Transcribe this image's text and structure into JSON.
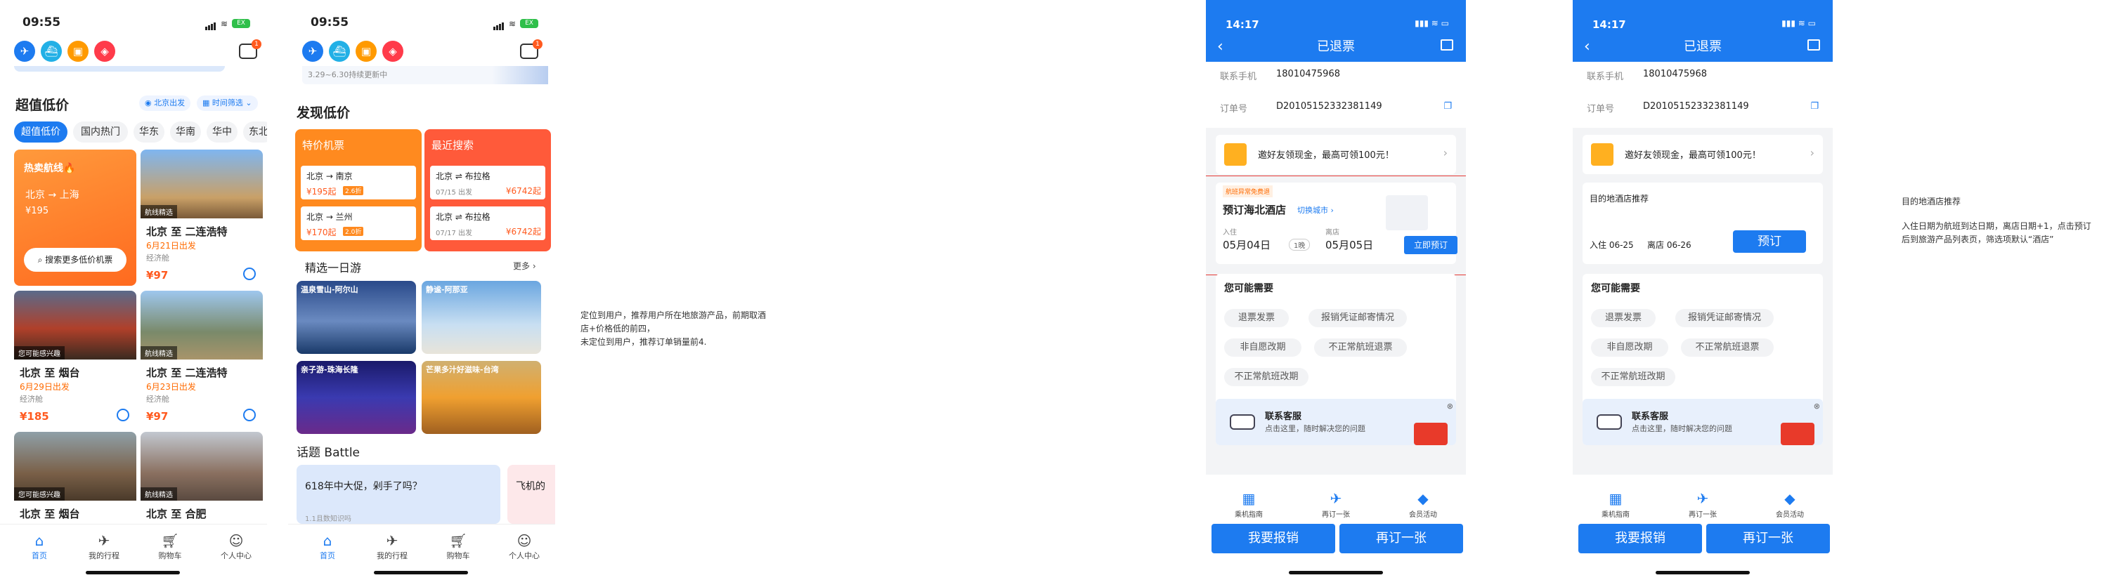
{
  "colors": {
    "primary": "#1d7bf0",
    "orange": "#ff6a00",
    "red": "#ff3b30"
  },
  "s1": {
    "time": "09:55",
    "section": "超值低价",
    "loc": "北京出发",
    "filter": "时间筛选",
    "chips": [
      "超值低价",
      "国内热门",
      "华东",
      "华南",
      "华中",
      "东北"
    ],
    "hot": {
      "tag": "热卖航线🔥",
      "route": "北京 → 上海",
      "price": "¥195",
      "search": "搜索更多低价机票"
    },
    "cards": [
      {
        "tag": "航线精选",
        "title": "北京 至 二连浩特",
        "date": "6月21日出发",
        "cls": "经济舱",
        "price": "¥97"
      },
      {
        "tag": "您可能感兴趣",
        "title": "北京 至 烟台",
        "date": "6月29日出发",
        "cls": "经济舱",
        "price": "¥185"
      },
      {
        "tag": "航线精选",
        "title": "北京 至 二连浩特",
        "date": "6月23日出发",
        "cls": "经济舱",
        "price": "¥97"
      },
      {
        "tag": "您可能感兴趣",
        "title": "北京 至 烟台",
        "date": "",
        "cls": "",
        "price": ""
      },
      {
        "tag": "航线精选",
        "title": "北京 至 合肥",
        "date": "",
        "cls": "",
        "price": ""
      }
    ],
    "tabs": [
      "首页",
      "我的行程",
      "购物车",
      "个人中心"
    ]
  },
  "s2": {
    "time": "09:55",
    "banner_note": "3.29~6.30持续更新中",
    "discover": "发现低价",
    "special": {
      "title": "特价机票",
      "rows": [
        {
          "route": "北京 → 南京",
          "price": "¥195起",
          "disc": "2.6折"
        },
        {
          "route": "北京 → 兰州",
          "price": "¥170起",
          "disc": "2.0折"
        }
      ]
    },
    "recent": {
      "title": "最近搜索",
      "rows": [
        {
          "route": "北京 ⇌ 布拉格",
          "date": "07/15 出发",
          "price": "¥6742起"
        },
        {
          "route": "北京 ⇌ 布拉格",
          "date": "07/17 出发",
          "price": "¥6742起"
        }
      ]
    },
    "daytrip": "精选一日游",
    "more": "更多",
    "trips": [
      "温泉雪山-阿尔山",
      "静谧-阿那亚",
      "亲子游-珠海长隆",
      "芒果多汁好滋味-台湾"
    ],
    "battle": "话题 Battle",
    "battle_cards": [
      "618年中大促，剁手了吗？",
      "飞机的"
    ],
    "battle_sub": "1.1且数知识吗",
    "tabs": [
      "首页",
      "我的行程",
      "购物车",
      "个人中心"
    ]
  },
  "note1": [
    "定位到用户，推荐用户所在地旅游产品，前期取酒",
    "店+价格低的前四，",
    "未定位到用户，推荐订单销量前4."
  ],
  "s3": {
    "time": "14:17",
    "title": "已退票",
    "phone_label": "联系手机",
    "phone": "18010475968",
    "order_label": "订单号",
    "order": "D20105152332381149",
    "invite": "邀好友领现金，最高可领100元！",
    "hotel_tag": "航班异常免费退",
    "hotel_title": "预订海北酒店",
    "switch_city": "切换城市 ›",
    "checkin_lbl": "入住",
    "checkin": "05月04日",
    "nights": "1晚",
    "checkout_lbl": "离店",
    "checkout": "05月05日",
    "book_now": "立即预订",
    "need": "您可能需要",
    "tickets": [
      "退票发票",
      "报销凭证邮寄情况",
      "非自愿改期",
      "不正常航班退票",
      "不正常航班改期"
    ],
    "service_title": "联系客服",
    "service_sub": "点击这里，随时解决您的问题",
    "bottom": [
      "乘机指南",
      "再订一张",
      "会员活动"
    ],
    "btn1": "我要报销",
    "btn2": "再订一张"
  },
  "s4": {
    "time": "14:17",
    "title": "已退票",
    "phone_label": "联系手机",
    "phone": "18010475968",
    "order_label": "订单号",
    "order": "D20105152332381149",
    "invite": "邀好友领现金，最高可领100元！",
    "hotel_title": "目的地酒店推荐",
    "checkin": "入住 06-25",
    "checkout": "离店 06-26",
    "book": "预订",
    "need": "您可能需要",
    "tickets": [
      "退票发票",
      "报销凭证邮寄情况",
      "非自愿改期",
      "不正常航班退票",
      "不正常航班改期"
    ],
    "service_title": "联系客服",
    "service_sub": "点击这里，随时解决您的问题",
    "bottom": [
      "乘机指南",
      "再订一张",
      "会员活动"
    ],
    "btn1": "我要报销",
    "btn2": "再订一张"
  },
  "note2": [
    "目的地酒店推荐",
    "入住日期为航班到达日期，离店日期+1，点击预订",
    "后到旅游产品列表页，筛选项默认“酒店”"
  ]
}
